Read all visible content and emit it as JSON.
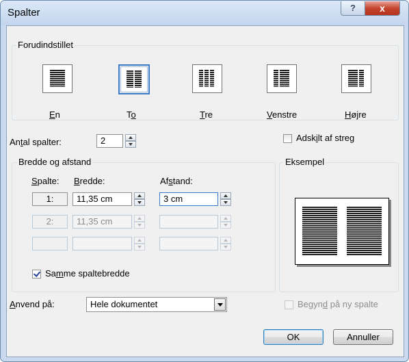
{
  "dialog": {
    "title": "Spalter",
    "help_glyph": "?",
    "close_glyph": "x"
  },
  "presets": {
    "legend": "Forudindstillet",
    "items": [
      {
        "key": "E",
        "rest": "n",
        "selected": false
      },
      {
        "key": "T",
        "rest": "o",
        "underline_second": true,
        "selected": true
      },
      {
        "key": "T",
        "rest": "re",
        "selected": false
      },
      {
        "key": "V",
        "rest": "enstre",
        "selected": false
      },
      {
        "key": "H",
        "rest": "øjre",
        "selected": false
      }
    ]
  },
  "count": {
    "label_pre": "An",
    "label_key": "t",
    "label_post": "al spalter:",
    "value": "2"
  },
  "separator": {
    "label_pre": "Adsk",
    "label_key": "i",
    "label_post": "lt af streg",
    "checked": false
  },
  "width_spacing": {
    "legend": "Bredde og afstand",
    "col_header_pre": "",
    "col_header_key": "S",
    "col_header_post": "palte:",
    "width_header_key": "B",
    "width_header_post": "redde:",
    "spacing_header_pre": "Af",
    "spacing_header_key": "s",
    "spacing_header_post": "tand:",
    "rows": [
      {
        "num": "1:",
        "width": "11,35 cm",
        "spacing": "3 cm",
        "enabled": true
      },
      {
        "num": "2:",
        "width": "11,35 cm",
        "spacing": "",
        "enabled": false
      },
      {
        "num": "",
        "width": "",
        "spacing": "",
        "enabled": false
      }
    ],
    "same_width_pre": "Sa",
    "same_width_key": "m",
    "same_width_post": "me spaltebredde",
    "same_width_checked": true
  },
  "example": {
    "legend": "Eksempel"
  },
  "apply": {
    "label_key": "A",
    "label_post": "nvend på:",
    "value": "Hele dokumentet"
  },
  "new_column": {
    "label_pre": "Begyn",
    "label_key": "d",
    "label_post": " på ny spalte",
    "checked": false
  },
  "buttons": {
    "ok": "OK",
    "cancel": "Annuller"
  },
  "colors": {
    "frame": "#c9daf0",
    "face": "#f0f0f0",
    "selection_border": "#3a78c8",
    "close_red": "#c4452f"
  }
}
